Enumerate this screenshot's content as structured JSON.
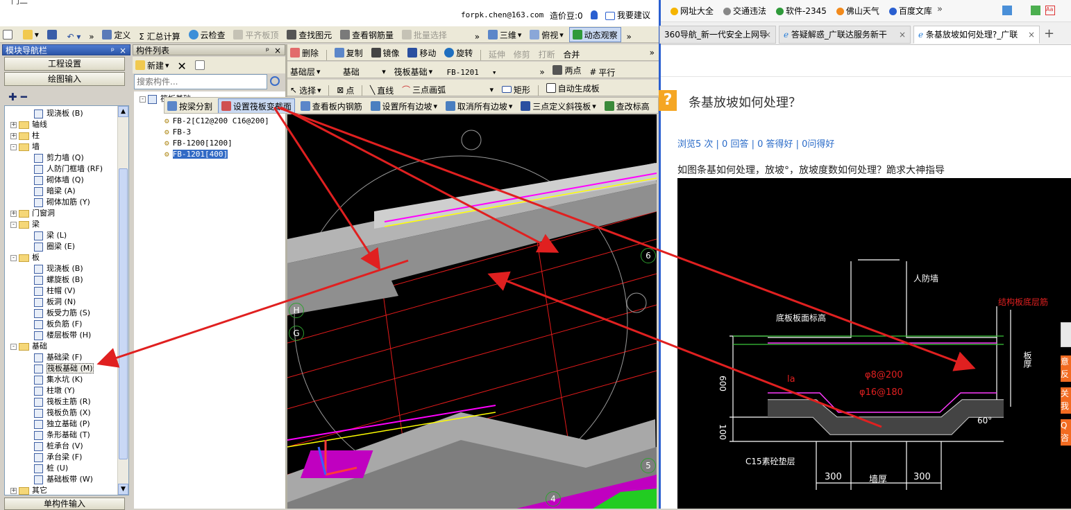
{
  "window": {
    "title": "广联达",
    "titlebar_text": "门二"
  },
  "account": {
    "email": "forpk.chen@163.com",
    "price_label": "造价豆:0",
    "suggest": "我要建议"
  },
  "toolbar1": {
    "items": [
      "定义",
      "Σ 汇总计算",
      "云检查",
      "平齐板顶",
      "查找图元",
      "查看钢筋量",
      "批量选择"
    ],
    "view_3d": "三维",
    "view_top": "俯视",
    "dynamic": "动态观察"
  },
  "toolbar2": {
    "items": [
      "删除",
      "复制",
      "镜像",
      "移动",
      "旋转",
      "延伸",
      "修剪",
      "打断",
      "合并"
    ]
  },
  "toolbar3": {
    "layer": "基础层",
    "cat": "基础",
    "type": "筏板基础",
    "comp": "FB-1201",
    "two_point": "两点",
    "parallel": "平行"
  },
  "toolbar4": {
    "select": "选择",
    "point": "点",
    "line": "直线",
    "arc": "三点画弧",
    "rect": "矩形",
    "auto": "自动生成板"
  },
  "toolbar5": {
    "items": [
      "按梁分割",
      "设置筏板变截面",
      "查看板内钢筋",
      "设置所有边坡",
      "取消所有边坡",
      "三点定义斜筏板",
      "查改标高"
    ]
  },
  "nav": {
    "title": "模块导航栏",
    "btn1": "工程设置",
    "btn2": "绘图输入",
    "bottom": "单构件输入",
    "tree": [
      {
        "label": "现浇板 (B)",
        "level": 2
      },
      {
        "label": "轴线",
        "level": 1,
        "folder": true,
        "tog": "+"
      },
      {
        "label": "柱",
        "level": 1,
        "folder": true,
        "tog": "+"
      },
      {
        "label": "墙",
        "level": 1,
        "folder": true,
        "tog": "-"
      },
      {
        "label": "剪力墙 (Q)",
        "level": 2
      },
      {
        "label": "人防门框墙 (RF)",
        "level": 2
      },
      {
        "label": "砌体墙 (Q)",
        "level": 2
      },
      {
        "label": "暗梁 (A)",
        "level": 2
      },
      {
        "label": "砌体加筋 (Y)",
        "level": 2
      },
      {
        "label": "门窗洞",
        "level": 1,
        "folder": true,
        "tog": "+"
      },
      {
        "label": "梁",
        "level": 1,
        "folder": true,
        "tog": "-"
      },
      {
        "label": "梁 (L)",
        "level": 2
      },
      {
        "label": "圈梁 (E)",
        "level": 2
      },
      {
        "label": "板",
        "level": 1,
        "folder": true,
        "tog": "-"
      },
      {
        "label": "现浇板 (B)",
        "level": 2
      },
      {
        "label": "螺旋板 (B)",
        "level": 2
      },
      {
        "label": "柱帽 (V)",
        "level": 2
      },
      {
        "label": "板洞 (N)",
        "level": 2
      },
      {
        "label": "板受力筋 (S)",
        "level": 2
      },
      {
        "label": "板负筋 (F)",
        "level": 2
      },
      {
        "label": "楼层板带 (H)",
        "level": 2
      },
      {
        "label": "基础",
        "level": 1,
        "folder": true,
        "tog": "-"
      },
      {
        "label": "基础梁 (F)",
        "level": 2
      },
      {
        "label": "筏板基础 (M)",
        "level": 2,
        "sel": true
      },
      {
        "label": "集水坑 (K)",
        "level": 2
      },
      {
        "label": "柱墩 (Y)",
        "level": 2
      },
      {
        "label": "筏板主筋 (R)",
        "level": 2
      },
      {
        "label": "筏板负筋 (X)",
        "level": 2
      },
      {
        "label": "独立基础 (P)",
        "level": 2
      },
      {
        "label": "条形基础 (T)",
        "level": 2
      },
      {
        "label": "桩承台 (V)",
        "level": 2
      },
      {
        "label": "承台梁 (F)",
        "level": 2
      },
      {
        "label": "桩 (U)",
        "level": 2
      },
      {
        "label": "基础板带 (W)",
        "level": 2
      },
      {
        "label": "其它",
        "level": 1,
        "folder": true,
        "tog": "+"
      }
    ]
  },
  "complist": {
    "title": "构件列表",
    "new": "新建",
    "search_ph": "搜索构件...",
    "root": "筏板基础",
    "items": [
      "FB-2[C12@200 C16@200]",
      "FB-3",
      "FB-1200[1200]",
      "FB-1201[400]"
    ]
  },
  "viewport": {
    "axis": [
      "H",
      "G",
      "6",
      "5",
      "4"
    ]
  },
  "browser": {
    "bookmarks": [
      "网址大全",
      "交通违法",
      "软件-2345",
      "佛山天气",
      "百度文库"
    ],
    "tabs": [
      "360导航_新一代安全上网导",
      "答疑解惑_广联达服务新干",
      "条基放坡如何处理?_广联"
    ],
    "question_title": "条基放坡如何处理？",
    "stats": "浏览5 次 | 0 回答 | 0 答得好 | 0问得好",
    "body": "如图条基如何处理，放坡°，放坡度数如何处理？跪求大神指导",
    "drawing": {
      "wall": "人防墙",
      "bottom_elev": "底板板面标高",
      "red_note": "结构板底层筋",
      "side": "板厚",
      "dim600": "600",
      "dim100": "100",
      "la": "la",
      "rebar1": "φ8@200",
      "rebar2": "φ16@180",
      "cushion": "C15素砼垫层",
      "d300a": "300",
      "wall_thick": "墙厚",
      "d300b": "300",
      "angle": "60°"
    },
    "side_btns": [
      "意反",
      "关我",
      "Q咨"
    ]
  }
}
